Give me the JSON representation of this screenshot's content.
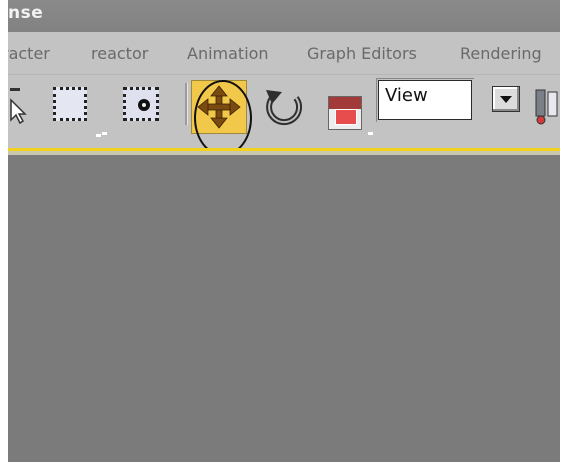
{
  "window": {
    "title_fragment": "nse"
  },
  "menu": {
    "items": [
      {
        "label": "racter"
      },
      {
        "label": "reactor"
      },
      {
        "label": "Animation"
      },
      {
        "label": "Graph Editors"
      },
      {
        "label": "Rendering"
      }
    ]
  },
  "toolbar": {
    "view_select": {
      "value": "View"
    },
    "icons": {
      "select_object": "cursor-arrow-icon",
      "select_region": "rectangular-region-icon",
      "select_window": "window-crossing-icon",
      "move": "move-arrows-icon",
      "rotate": "rotate-icon",
      "scale": "scale-icon",
      "dropdown": "chevron-down-icon",
      "pivot": "pivot-center-icon"
    }
  },
  "colors": {
    "active_tool": "#f2c84a",
    "viewport_border": "#f4d11a",
    "viewport_bg": "#7b7b7b"
  }
}
